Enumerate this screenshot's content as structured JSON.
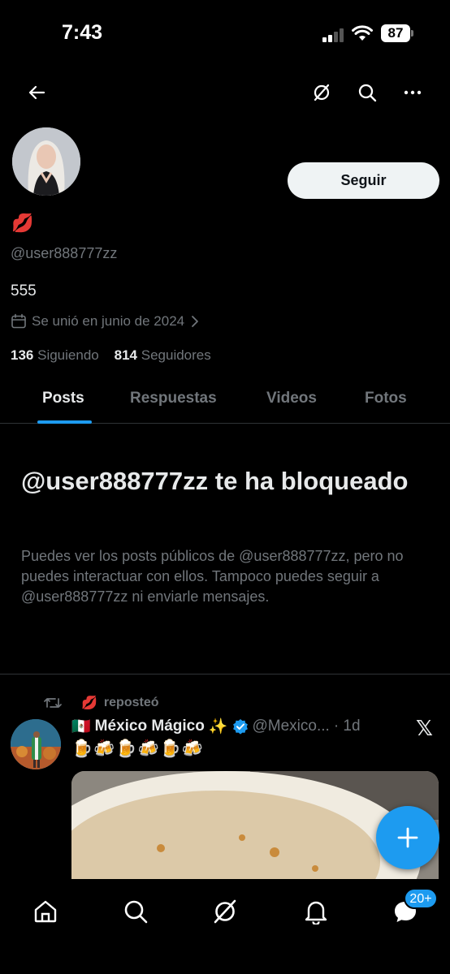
{
  "status": {
    "time": "7:43",
    "battery": "87"
  },
  "profile": {
    "follow_label": "Seguir",
    "display_name_emoji": "💋",
    "handle": "@user888777zz",
    "bio": "555",
    "joined": "Se unió en junio de 2024",
    "following_count": "136",
    "following_label": "Siguiendo",
    "followers_count": "814",
    "followers_label": "Seguidores"
  },
  "tabs": [
    {
      "label": "Posts"
    },
    {
      "label": "Respuestas"
    },
    {
      "label": "Videos"
    },
    {
      "label": "Fotos"
    }
  ],
  "blocked": {
    "title": "@user888777zz te ha bloqueado",
    "body": "Puedes ver los posts públicos de @user888777zz, pero no puedes interactuar con ellos. Tampoco puedes seguir a @user888777zz ni enviarle mensajes."
  },
  "post": {
    "repost_emoji": "💋",
    "repost_label": "reposteó",
    "author_flag": "🇲🇽",
    "author_name": "México Mágico",
    "author_sparkle": "✨",
    "author_handle": "@Mexico...",
    "time": "· 1d",
    "text": "🍺🍻🍺🍻🍺🍻"
  },
  "bottom_nav": {
    "badge": "20+"
  },
  "colors": {
    "accent": "#1d9bf0",
    "background": "#000000",
    "secondary_text": "#71767b"
  }
}
